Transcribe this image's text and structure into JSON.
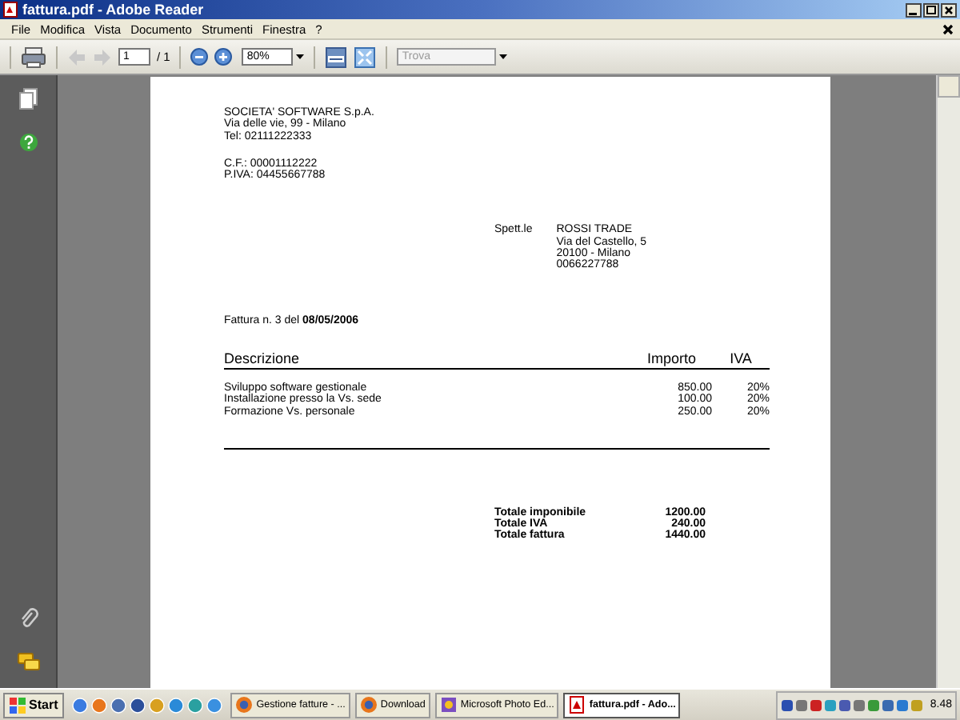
{
  "window": {
    "title": "fattura.pdf - Adobe Reader"
  },
  "menu": [
    "File",
    "Modifica",
    "Vista",
    "Documento",
    "Strumenti",
    "Finestra",
    "?"
  ],
  "toolbar": {
    "page": "1",
    "page_total": "/ 1",
    "zoom": "80%",
    "search_placeholder": "Trova"
  },
  "document": {
    "sender": [
      "SOCIETA' SOFTWARE S.p.A.",
      "Via delle vie, 99 - Milano",
      "Tel: 02111222333"
    ],
    "tax_ids": [
      "C.F.: 00001112222",
      "P.IVA: 04455667788"
    ],
    "recipient_label": "Spett.le",
    "recipient": [
      "ROSSI TRADE",
      "Via del Castello, 5",
      "20100 - Milano",
      "0066227788"
    ],
    "invoice_line": "Fattura n. 3 del **08/05/2006**",
    "columns": [
      "Descrizione",
      "Importo",
      "IVA"
    ],
    "rows": [
      {
        "description": "Sviluppo software gestionale",
        "amount": "850.00",
        "vat": "20%"
      },
      {
        "description": "Installazione presso la Vs. sede",
        "amount": "100.00",
        "vat": "20%"
      },
      {
        "description": "Formazione Vs. personale",
        "amount": "250.00",
        "vat": "20%"
      }
    ],
    "totals": [
      {
        "label": "Totale imponibile",
        "value": "1200.00"
      },
      {
        "label": "Totale IVA",
        "value": "240.00"
      },
      {
        "label": "Totale fattura",
        "value": "1440.00"
      }
    ]
  },
  "taskbar": {
    "start": "Start",
    "tasks": [
      {
        "label": "Gestione fatture - ...",
        "kind": "browser",
        "selected": false
      },
      {
        "label": "Download",
        "kind": "browser",
        "selected": false
      },
      {
        "label": "Microsoft Photo Ed...",
        "kind": "photo",
        "selected": false
      },
      {
        "label": "fattura.pdf - Ado...",
        "kind": "pdf",
        "selected": true
      }
    ],
    "clock": "8.48"
  }
}
